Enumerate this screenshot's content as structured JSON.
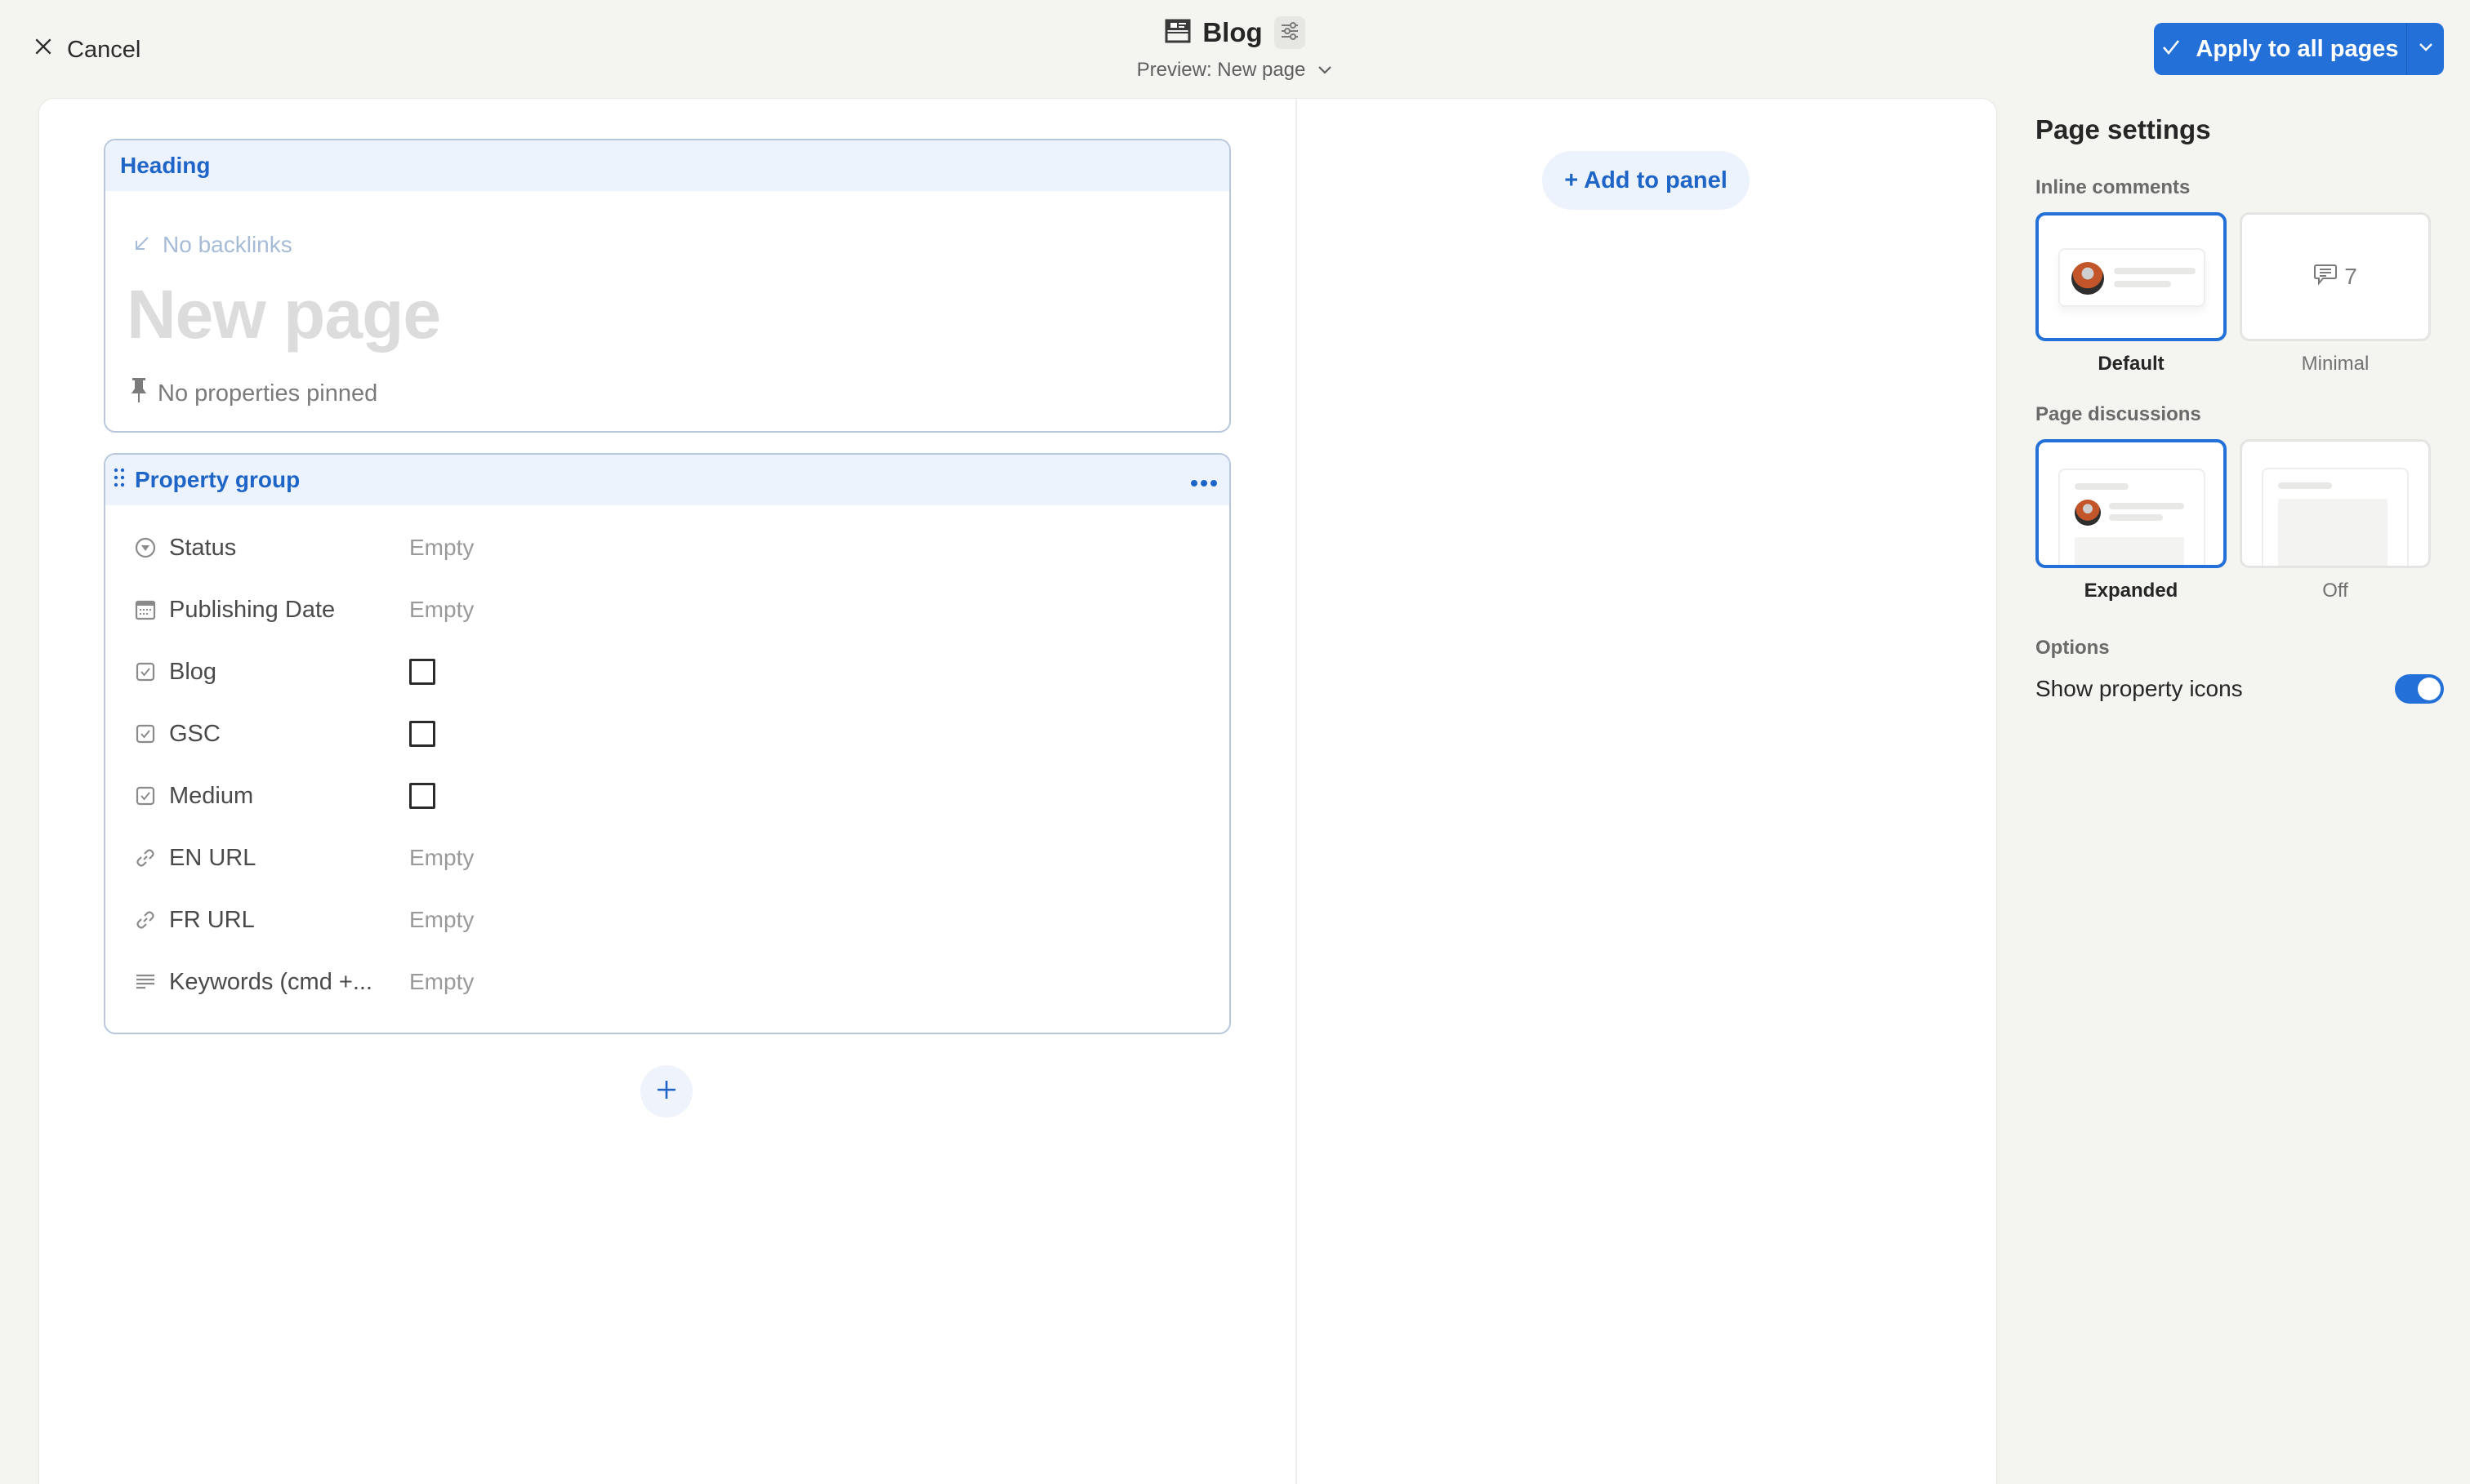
{
  "topbar": {
    "cancel_label": "Cancel",
    "title": "Blog",
    "preview_label": "Preview: New page",
    "apply_label": "Apply to all pages",
    "accent_color": "#2370d8"
  },
  "icons": {
    "cancel": "close-icon",
    "database": "database-layout-icon",
    "customize": "sliders-icon",
    "preview_dropdown": "chevron-down-icon",
    "apply": "check-icon",
    "apply_more": "chevron-down-icon"
  },
  "heading_card": {
    "label": "Heading",
    "backlinks": "No backlinks",
    "page_title_placeholder": "New page",
    "pinned": "No properties pinned"
  },
  "property_group": {
    "label": "Property group",
    "properties": [
      {
        "name": "Status",
        "icon": "status-icon",
        "type": "status",
        "value": "Empty"
      },
      {
        "name": "Publishing Date",
        "icon": "calendar-icon",
        "type": "date",
        "value": "Empty"
      },
      {
        "name": "Blog",
        "icon": "checkbox-type-icon",
        "type": "checkbox",
        "value": false
      },
      {
        "name": "GSC",
        "icon": "checkbox-type-icon",
        "type": "checkbox",
        "value": false
      },
      {
        "name": "Medium",
        "icon": "checkbox-type-icon",
        "type": "checkbox",
        "value": false
      },
      {
        "name": "EN URL",
        "icon": "link-icon",
        "type": "url",
        "value": "Empty"
      },
      {
        "name": "FR URL",
        "icon": "link-icon",
        "type": "url",
        "value": "Empty"
      },
      {
        "name": "Keywords (cmd +...",
        "icon": "text-icon",
        "type": "text",
        "value": "Empty"
      }
    ]
  },
  "side_panel": {
    "add_label": "+ Add to panel"
  },
  "settings": {
    "title": "Page settings",
    "inline_comments": {
      "label": "Inline comments",
      "options": [
        {
          "label": "Default",
          "selected": true
        },
        {
          "label": "Minimal",
          "selected": false,
          "count": "7"
        }
      ]
    },
    "page_discussions": {
      "label": "Page discussions",
      "options": [
        {
          "label": "Expanded",
          "selected": true
        },
        {
          "label": "Off",
          "selected": false
        }
      ]
    },
    "options": {
      "label": "Options",
      "show_property_icons_label": "Show property icons",
      "show_property_icons": true
    }
  }
}
